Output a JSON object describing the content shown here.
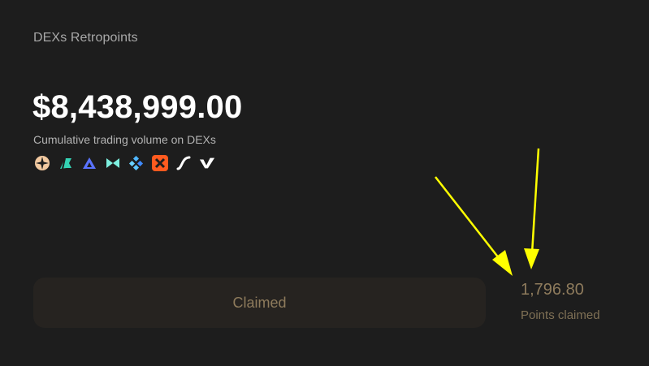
{
  "card": {
    "title": "DEXs Retropoints",
    "amount": "$8,438,999.00",
    "amount_caption": "Cumulative trading volume on DEXs",
    "dex_icons": [
      "dex-compass-icon",
      "dex-flag-icon",
      "dex-triangle-icon",
      "dex-bowtie-icon",
      "dex-diamond-icon",
      "dex-x-icon",
      "dex-swirl-icon",
      "dex-v-icon"
    ],
    "claim_button_label": "Claimed",
    "points_value": "1,796.80",
    "points_label": "Points claimed"
  },
  "colors": {
    "background": "#1d1d1d",
    "button_background": "#262320",
    "muted_gold": "#8e7b5c",
    "annotation_arrow": "#ffff00"
  }
}
